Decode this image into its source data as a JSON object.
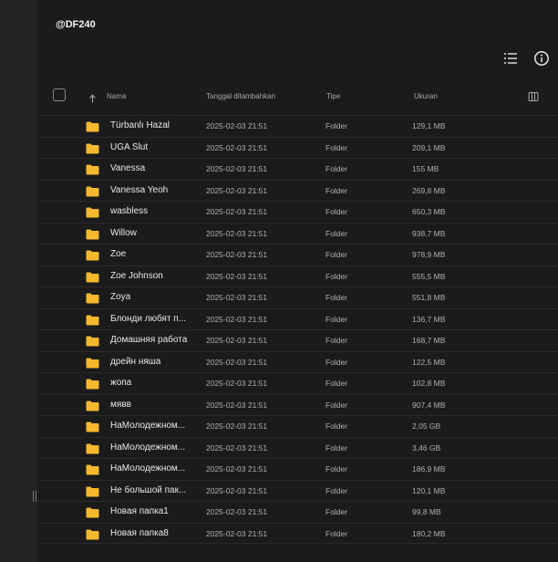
{
  "header": {
    "title": "@DF240"
  },
  "columns": {
    "name": "Nama",
    "date_added": "Tanggal ditambahkan",
    "type": "Tipe",
    "size": "Ukuran"
  },
  "colors": {
    "folder": "#f5b82e",
    "background": "#1b1b1b",
    "sidebar": "#242424"
  },
  "rows": [
    {
      "name": "Türbanlı Hazal",
      "date": "2025-02-03 21:51",
      "type": "Folder",
      "size": "129,1 MB"
    },
    {
      "name": "UGA Slut",
      "date": "2025-02-03 21:51",
      "type": "Folder",
      "size": "209,1 MB"
    },
    {
      "name": "Vanessa",
      "date": "2025-02-03 21:51",
      "type": "Folder",
      "size": "155 MB"
    },
    {
      "name": "Vanessa Yeoh",
      "date": "2025-02-03 21:51",
      "type": "Folder",
      "size": "269,8 MB"
    },
    {
      "name": "wasbless",
      "date": "2025-02-03 21:51",
      "type": "Folder",
      "size": "650,3 MB"
    },
    {
      "name": "Willow",
      "date": "2025-02-03 21:51",
      "type": "Folder",
      "size": "938,7 MB"
    },
    {
      "name": "Zoe",
      "date": "2025-02-03 21:51",
      "type": "Folder",
      "size": "978,9 MB"
    },
    {
      "name": "Zoe Johnson",
      "date": "2025-02-03 21:51",
      "type": "Folder",
      "size": "555,5 MB"
    },
    {
      "name": "Zoya",
      "date": "2025-02-03 21:51",
      "type": "Folder",
      "size": "551,8 MB"
    },
    {
      "name": "Блонди любят п...",
      "date": "2025-02-03 21:51",
      "type": "Folder",
      "size": "136,7 MB"
    },
    {
      "name": "Домашняя работа",
      "date": "2025-02-03 21:51",
      "type": "Folder",
      "size": "168,7 MB"
    },
    {
      "name": "дрейн няша",
      "date": "2025-02-03 21:51",
      "type": "Folder",
      "size": "122,5 MB"
    },
    {
      "name": "жопа",
      "date": "2025-02-03 21:51",
      "type": "Folder",
      "size": "102,8 MB"
    },
    {
      "name": "мявв",
      "date": "2025-02-03 21:51",
      "type": "Folder",
      "size": "907,4 MB"
    },
    {
      "name": "НаМолодежном...",
      "date": "2025-02-03 21:51",
      "type": "Folder",
      "size": "2,05 GB"
    },
    {
      "name": "НаМолодежном...",
      "date": "2025-02-03 21:51",
      "type": "Folder",
      "size": "3,46 GB"
    },
    {
      "name": "НаМолодежном...",
      "date": "2025-02-03 21:51",
      "type": "Folder",
      "size": "186,9 MB"
    },
    {
      "name": "Не большой пак...",
      "date": "2025-02-03 21:51",
      "type": "Folder",
      "size": "120,1 MB"
    },
    {
      "name": "Новая папка1",
      "date": "2025-02-03 21:51",
      "type": "Folder",
      "size": "99,8 MB"
    },
    {
      "name": "Новая папка8",
      "date": "2025-02-03 21:51",
      "type": "Folder",
      "size": "180,2 MB"
    }
  ]
}
